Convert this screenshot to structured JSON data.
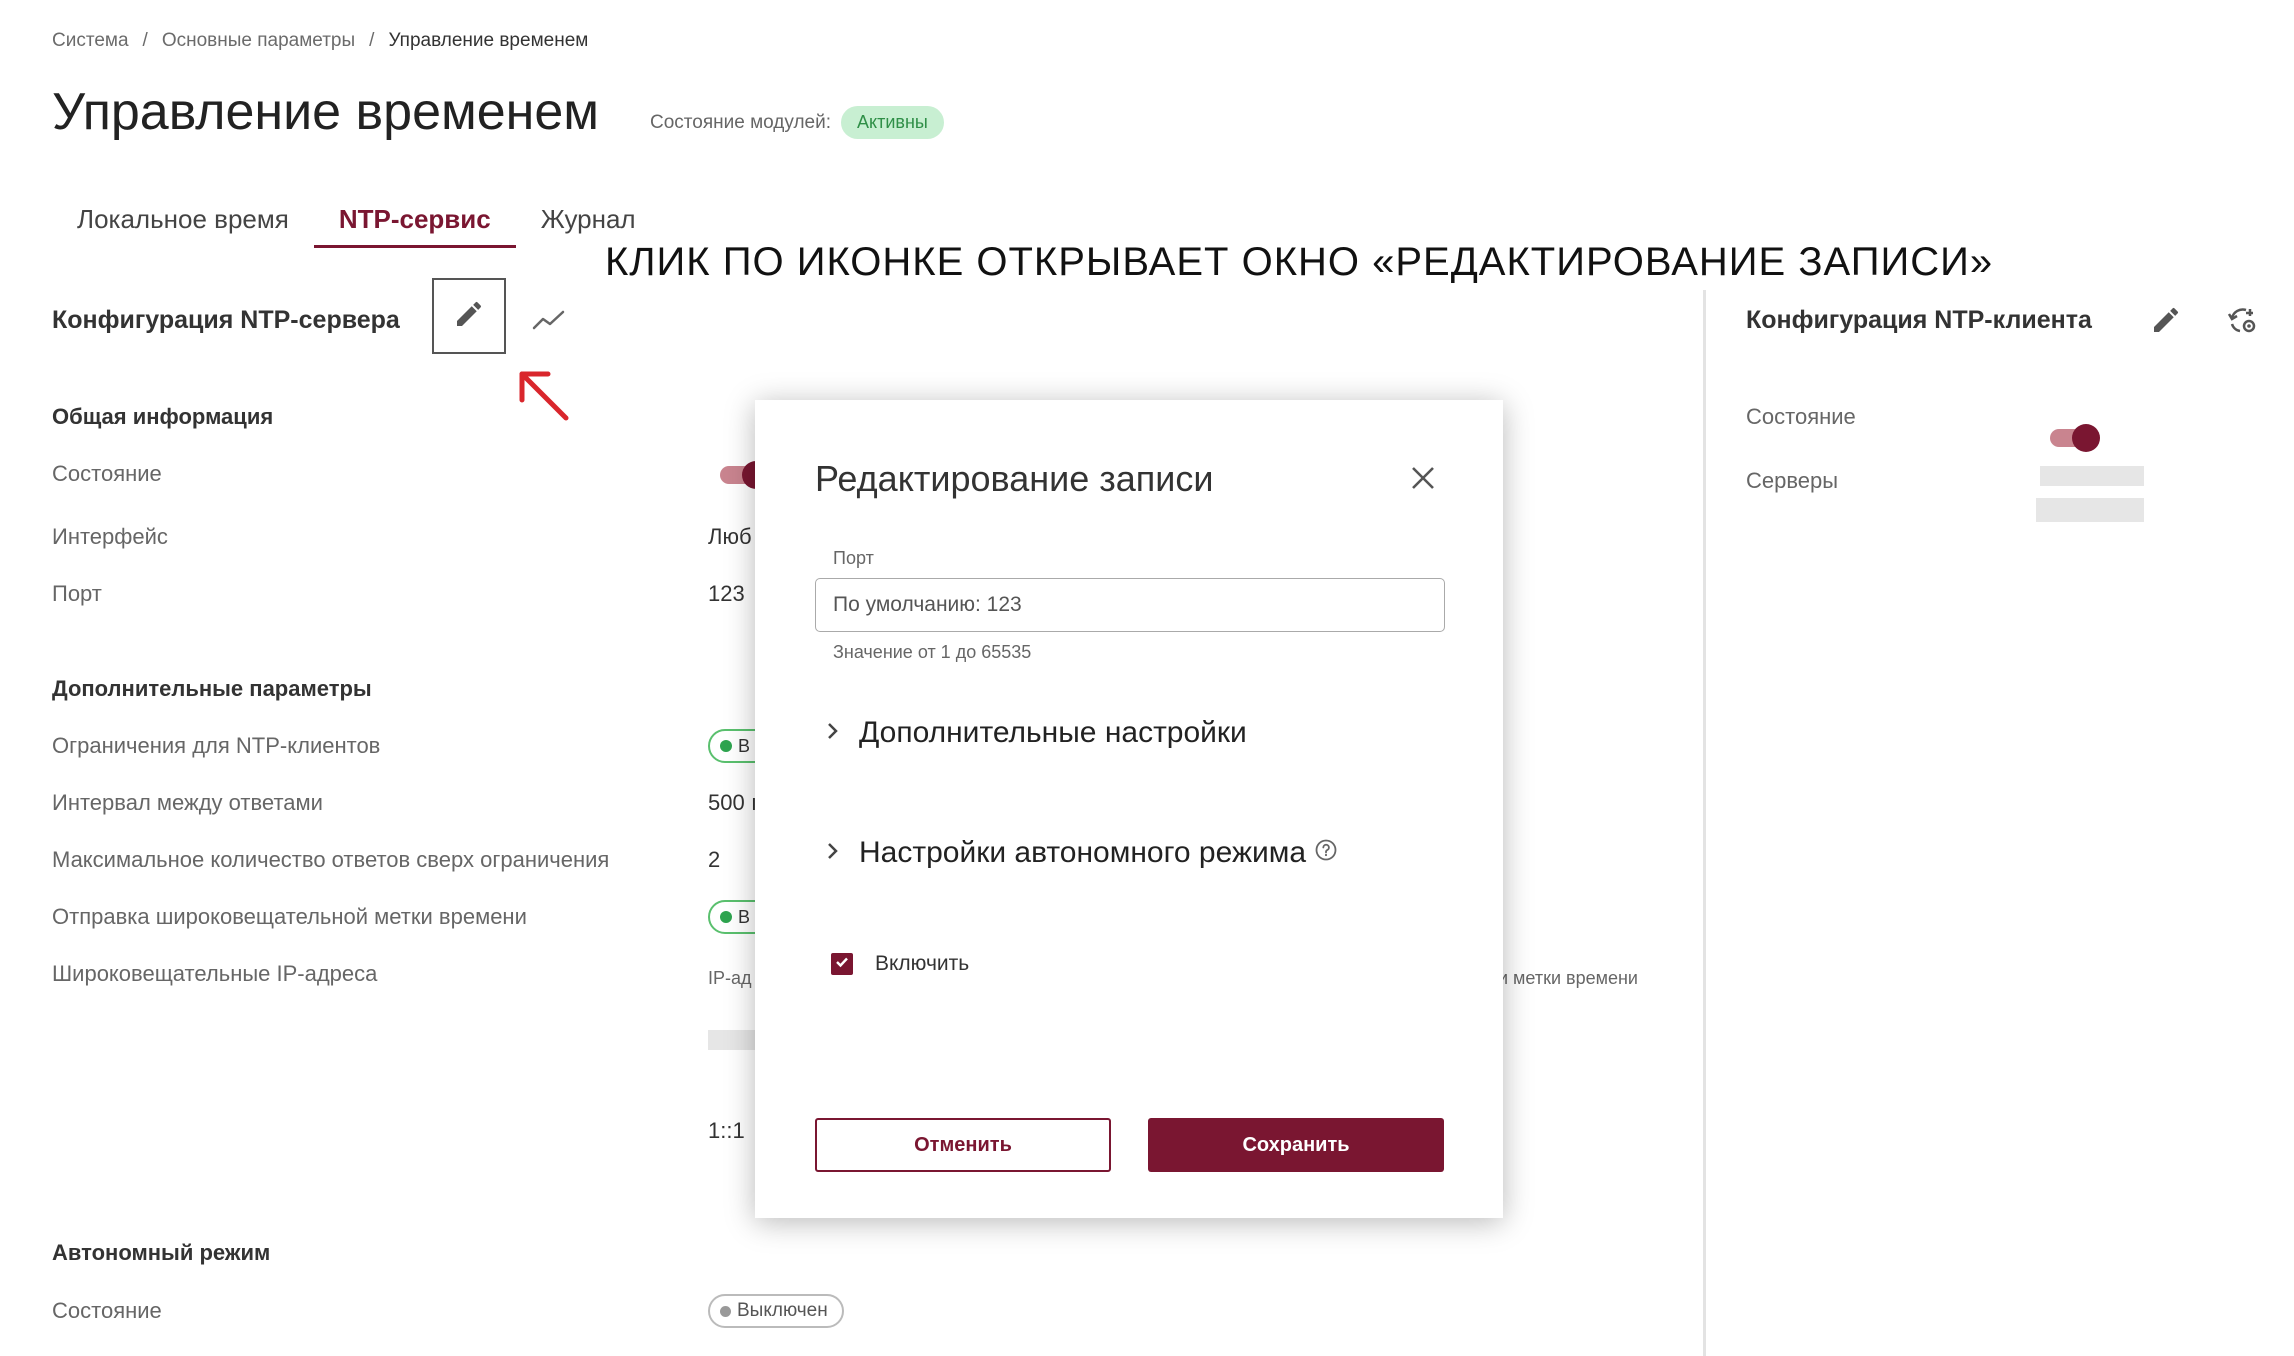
{
  "breadcrumb": {
    "items": [
      "Система",
      "Основные параметры",
      "Управление временем"
    ],
    "separator": "/"
  },
  "page": {
    "title": "Управление временем",
    "module_status_label": "Состояние модулей:",
    "module_status_value": "Активны"
  },
  "tabs": [
    {
      "label": "Локальное время",
      "active": false
    },
    {
      "label": "NTP-сервис",
      "active": true
    },
    {
      "label": "Журнал",
      "active": false
    }
  ],
  "annotation": "КЛИК ПО ИКОНКЕ ОТКРЫВАЕТ ОКНО «РЕДАКТИРОВАНИЕ ЗАПИСИ»",
  "server": {
    "title": "Конфигурация NTP-сервера",
    "general_title": "Общая информация",
    "state_label": "Состояние",
    "interface_label": "Интерфейс",
    "interface_value": "Люб",
    "port_label": "Порт",
    "port_value": "123",
    "extra_title": "Дополнительные параметры",
    "restrictions_label": "Ограничения для NTP-клиентов",
    "restrictions_value": "В",
    "interval_label": "Интервал между ответами",
    "interval_value": "500 ı",
    "max_answers_label": "Максимальное количество ответов сверх ограничения",
    "max_answers_value": "2",
    "broadcast_label": "Отправка широковещательной метки времени",
    "broadcast_value": "В",
    "broadcast_ips_label": "Широковещательные IP-адреса",
    "broadcast_ips_header": "IP-ад",
    "broadcast_ips_header_right": "и метки времени",
    "broadcast_ip_2": "1::1",
    "autonomous_title": "Автономный режим",
    "autonomous_state_label": "Состояние",
    "autonomous_state_value": "Выключен"
  },
  "client": {
    "title": "Конфигурация NTP-клиента",
    "state_label": "Состояние",
    "servers_label": "Серверы"
  },
  "modal": {
    "title": "Редактирование записи",
    "port_label": "Порт",
    "port_placeholder": "По умолчанию: 123",
    "port_helper": "Значение от 1 до 65535",
    "advanced_label": "Дополнительные настройки",
    "autonomous_label": "Настройки автономного режима",
    "enable_label": "Включить",
    "enable_checked": true,
    "cancel_label": "Отменить",
    "save_label": "Сохранить"
  },
  "colors": {
    "accent": "#7a1631",
    "success": "#2ea44f",
    "success_bg": "#c8efd2",
    "annotation_arrow": "#d9262c"
  },
  "icons": [
    "pencil-icon",
    "chart-line-icon",
    "arrow-up-left-icon",
    "sync-settings-icon",
    "close-icon",
    "chevron-right-icon",
    "help-circle-icon",
    "check-icon"
  ]
}
